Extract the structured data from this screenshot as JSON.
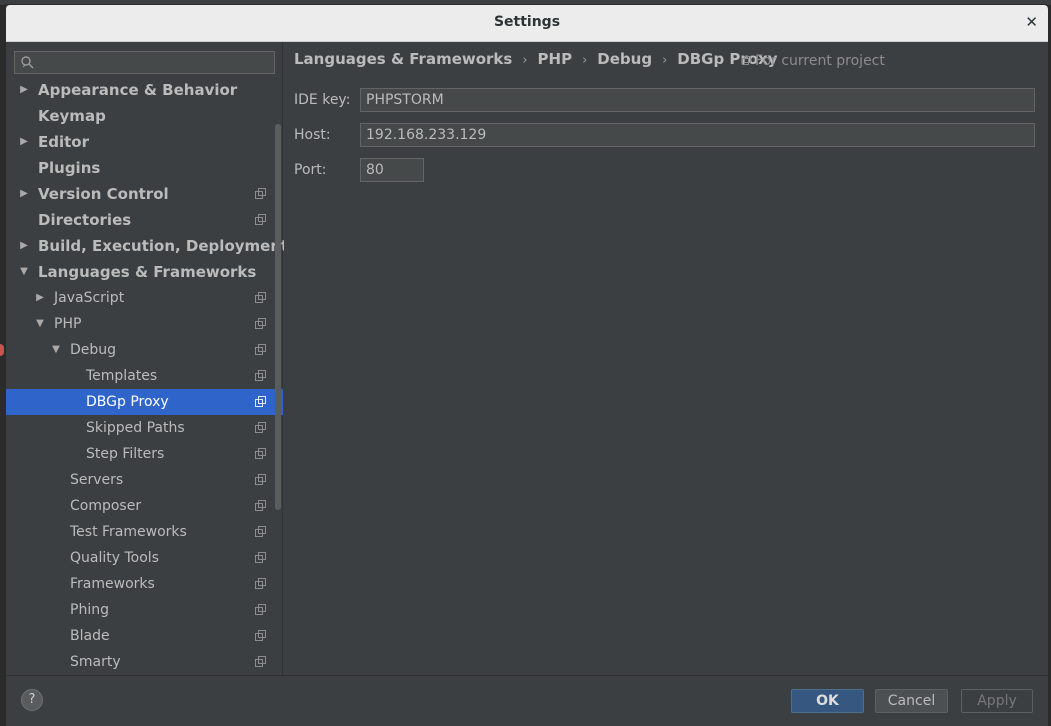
{
  "window": {
    "title": "Settings"
  },
  "breadcrumb": [
    "Languages & Frameworks",
    "PHP",
    "Debug",
    "DBGp Proxy"
  ],
  "scope_label": "For current project",
  "search": {
    "placeholder": ""
  },
  "tree": [
    {
      "label": "Appearance & Behavior",
      "level": 0,
      "arrow": "right",
      "bold": true,
      "proj": false
    },
    {
      "label": "Keymap",
      "level": 0,
      "arrow": "",
      "bold": true,
      "proj": false
    },
    {
      "label": "Editor",
      "level": 0,
      "arrow": "right",
      "bold": true,
      "proj": false
    },
    {
      "label": "Plugins",
      "level": 0,
      "arrow": "",
      "bold": true,
      "proj": false
    },
    {
      "label": "Version Control",
      "level": 0,
      "arrow": "right",
      "bold": true,
      "proj": true
    },
    {
      "label": "Directories",
      "level": 0,
      "arrow": "",
      "bold": true,
      "proj": true
    },
    {
      "label": "Build, Execution, Deployment",
      "level": 0,
      "arrow": "right",
      "bold": true,
      "proj": false
    },
    {
      "label": "Languages & Frameworks",
      "level": 0,
      "arrow": "down",
      "bold": true,
      "proj": false
    },
    {
      "label": "JavaScript",
      "level": 1,
      "arrow": "right",
      "bold": false,
      "proj": true
    },
    {
      "label": "PHP",
      "level": 1,
      "arrow": "down",
      "bold": false,
      "proj": true
    },
    {
      "label": "Debug",
      "level": 2,
      "arrow": "down",
      "bold": false,
      "proj": true
    },
    {
      "label": "Templates",
      "level": 3,
      "arrow": "",
      "bold": false,
      "proj": true
    },
    {
      "label": "DBGp Proxy",
      "level": 3,
      "arrow": "",
      "bold": false,
      "proj": true,
      "selected": true
    },
    {
      "label": "Skipped Paths",
      "level": 3,
      "arrow": "",
      "bold": false,
      "proj": true
    },
    {
      "label": "Step Filters",
      "level": 3,
      "arrow": "",
      "bold": false,
      "proj": true
    },
    {
      "label": "Servers",
      "level": 2,
      "arrow": "",
      "bold": false,
      "proj": true
    },
    {
      "label": "Composer",
      "level": 2,
      "arrow": "",
      "bold": false,
      "proj": true
    },
    {
      "label": "Test Frameworks",
      "level": 2,
      "arrow": "",
      "bold": false,
      "proj": true
    },
    {
      "label": "Quality Tools",
      "level": 2,
      "arrow": "",
      "bold": false,
      "proj": true
    },
    {
      "label": "Frameworks",
      "level": 2,
      "arrow": "",
      "bold": false,
      "proj": true
    },
    {
      "label": "Phing",
      "level": 2,
      "arrow": "",
      "bold": false,
      "proj": true
    },
    {
      "label": "Blade",
      "level": 2,
      "arrow": "",
      "bold": false,
      "proj": true
    },
    {
      "label": "Smarty",
      "level": 2,
      "arrow": "",
      "bold": false,
      "proj": true
    }
  ],
  "form": {
    "ide_key_label": "IDE key:",
    "ide_key_value": "PHPSTORM",
    "host_label": "Host:",
    "host_value": "192.168.233.129",
    "port_label": "Port:",
    "port_value": "80"
  },
  "buttons": {
    "help": "?",
    "ok": "OK",
    "cancel": "Cancel",
    "apply": "Apply"
  },
  "colors": {
    "selection": "#2f65ca",
    "background": "#3c3f41",
    "ok_button": "#365880"
  }
}
